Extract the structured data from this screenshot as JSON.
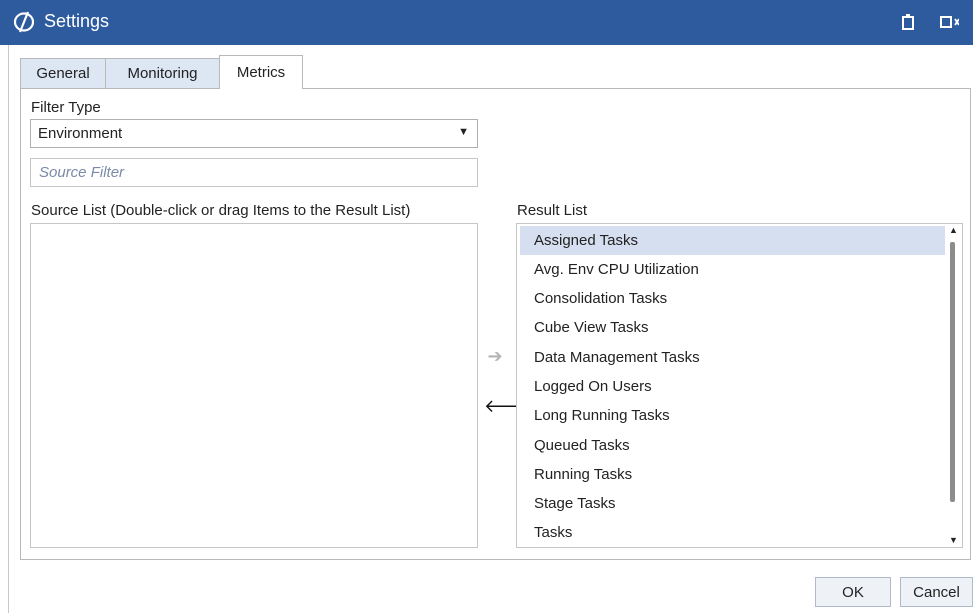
{
  "window": {
    "title": "Settings",
    "accent_color": "#2e5b9e",
    "icons": [
      "app-logo-icon",
      "restore-icon",
      "maximize-icon"
    ]
  },
  "tabs": [
    {
      "label": "General",
      "active": false
    },
    {
      "label": "Monitoring",
      "active": false
    },
    {
      "label": "Metrics",
      "active": true
    }
  ],
  "filter": {
    "type_label": "Filter Type",
    "type_value": "Environment",
    "source_filter_placeholder": "Source Filter"
  },
  "source_list": {
    "label": "Source List (Double-click or drag Items to the Result List)",
    "items": []
  },
  "result_list": {
    "label": "Result List",
    "selected_index": 0,
    "items": [
      "Assigned Tasks",
      "Avg. Env CPU Utilization",
      "Consolidation Tasks",
      "Cube View Tasks",
      "Data Management Tasks",
      "Logged On Users",
      "Long Running Tasks",
      "Queued Tasks",
      "Running Tasks",
      "Stage Tasks",
      "Tasks"
    ]
  },
  "transfer": {
    "add_enabled": false,
    "remove_enabled": true
  },
  "buttons": {
    "ok": "OK",
    "cancel": "Cancel"
  }
}
